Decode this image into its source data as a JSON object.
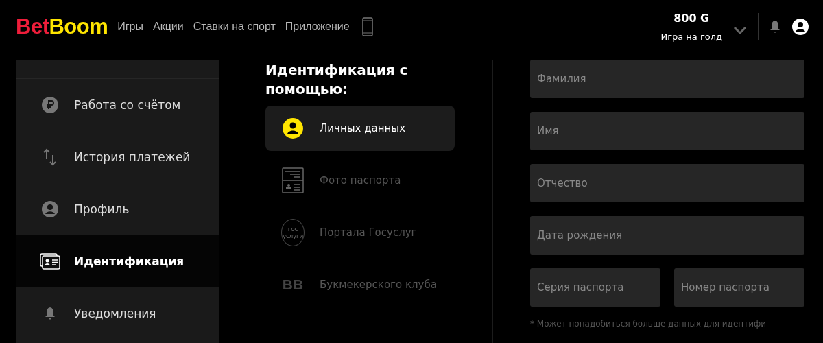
{
  "logo": {
    "part_1": "Bet",
    "part_2": "Boom"
  },
  "nav": [
    "Игры",
    "Акции",
    "Ставки на спорт",
    "Приложение"
  ],
  "balance": {
    "amount": "800 G",
    "label": "Игра на голд"
  },
  "sidebar": {
    "items": [
      {
        "label": "Работа со счётом",
        "kind": "ruble",
        "selected": false
      },
      {
        "label": "История платежей",
        "kind": "transfer",
        "selected": false
      },
      {
        "label": "Профиль",
        "kind": "profile",
        "selected": false
      },
      {
        "label": "Идентификация",
        "kind": "id",
        "selected": true
      },
      {
        "label": "Уведомления",
        "kind": "bell",
        "selected": false
      }
    ]
  },
  "identification": {
    "title": "Идентификация с помощью:",
    "options": [
      {
        "label": "Личных данных",
        "kind": "person",
        "selected": true
      },
      {
        "label": "Фото паспорта",
        "kind": "passport",
        "selected": false
      },
      {
        "label": "Портала Госуслуг",
        "kind": "gosuslugi",
        "selected": false,
        "icon_text": [
          "гос",
          "услуги"
        ]
      },
      {
        "label": "Букмекерского клуба",
        "kind": "club",
        "selected": false,
        "icon_text": [
          "BB"
        ]
      }
    ]
  },
  "form": {
    "rows": [
      [
        {
          "placeholder": "Фамилия"
        }
      ],
      [
        {
          "placeholder": "Имя"
        }
      ],
      [
        {
          "placeholder": "Отчество"
        }
      ],
      [
        {
          "placeholder": "Дата рождения"
        }
      ],
      [
        {
          "placeholder": "Серия паспорта"
        },
        {
          "placeholder": "Номер паспорта"
        }
      ]
    ],
    "note": "* Может понадобиться больше данных для идентифи"
  }
}
